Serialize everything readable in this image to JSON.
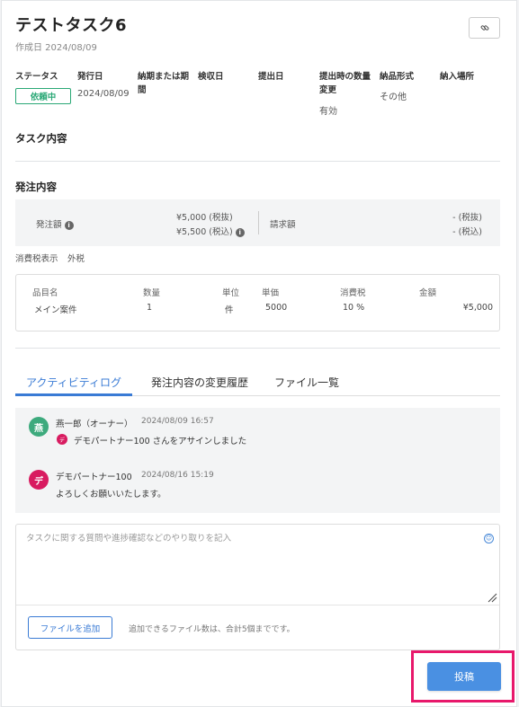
{
  "task": {
    "title": "テストタスク6",
    "created": "作成日 2024/08/09"
  },
  "meta": {
    "headers": {
      "status": "ステータス",
      "issue_date": "発行日",
      "deadline_line1": "納期または期",
      "deadline_line2": "間",
      "inspection_date": "検収日",
      "submission_date": "提出日",
      "qty_change_line1": "提出時の数量",
      "qty_change_line2": "変更",
      "delivery_format": "納品形式",
      "delivery_place": "納入場所"
    },
    "values": {
      "status": "依頼中",
      "issue_date": "2024/08/09",
      "qty_change": "有効",
      "delivery_format": "その他"
    }
  },
  "sections": {
    "task_content": "タスク内容",
    "order_content": "発注内容"
  },
  "amount": {
    "order_label": "発注額",
    "order_excl": "¥5,000 (税抜)",
    "order_incl": "¥5,500 (税込)",
    "billing_label": "請求額",
    "billing_excl": "- (税抜)",
    "billing_incl": "- (税込)"
  },
  "tax_display": {
    "label": "消費税表示",
    "value": "外税"
  },
  "items": {
    "headers": [
      "品目名",
      "数量",
      "単位",
      "単価",
      "消費税",
      "金額"
    ],
    "rows": [
      [
        "メイン案件",
        "1",
        "件",
        "5000",
        "10 %",
        "¥5,000"
      ]
    ]
  },
  "tabs": [
    "アクティビティログ",
    "発注内容の変更履歴",
    "ファイル一覧"
  ],
  "activity": [
    {
      "avatar": "燕",
      "avatar_color": "#3daa7d",
      "name": "燕一郎（オーナー）",
      "time": "2024/08/09 16:57",
      "sub_avatar": "デ",
      "sub_avatar_color": "#d81b60",
      "text": "デモパートナー100 さんをアサインしました"
    },
    {
      "avatar": "デ",
      "avatar_color": "#d81b60",
      "name": "デモパートナー100",
      "time": "2024/08/16 15:19",
      "text": "よろしくお願いいたします。"
    }
  ],
  "comment": {
    "placeholder": "タスクに関する質問や進捗確認などのやり取りを記入",
    "value": "",
    "add_file": "ファイルを追加",
    "file_note": "追加できるファイル数は、合計5個までです。",
    "post": "投稿"
  },
  "colors": {
    "accent": "#3a7bd5",
    "status_green": "#2aa876",
    "highlight": "#e8186b",
    "post_button": "#4a90e2"
  }
}
